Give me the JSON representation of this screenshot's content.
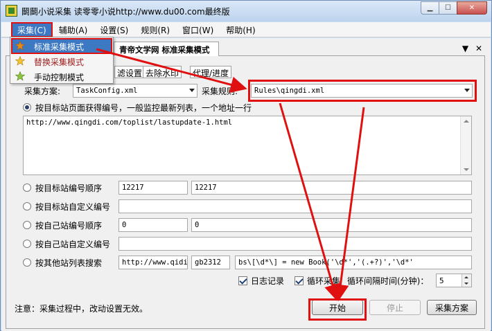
{
  "window": {
    "title": "鬬鬬小说采集 读零零小说http://www.du00.com最终版",
    "controls": [
      "minimize-icon",
      "maximize-icon",
      "close-icon"
    ]
  },
  "menubar": {
    "items": [
      "采集(C)",
      "辅助(A)",
      "设置(S)",
      "规则(R)",
      "窗口(W)",
      "帮助(H)"
    ],
    "active_index": 0
  },
  "dropdown": {
    "items": [
      {
        "label": "标准采集模式",
        "icon": "star-icon",
        "highlighted": true
      },
      {
        "label": "替换采集模式",
        "icon": "star-icon"
      },
      {
        "label": "手动控制模式",
        "icon": "star-icon"
      }
    ]
  },
  "document_tab": {
    "label": "青帝文学网 标准采集模式",
    "controls": [
      "▼",
      "✕"
    ]
  },
  "sub_tabs": [
    "滤设置",
    "去除水印",
    "代理/进度"
  ],
  "scheme": {
    "label": "采集方案:",
    "value": "TaskConfig.xml"
  },
  "rule": {
    "label": "采集规则:",
    "value": "Rules\\qingdi.xml"
  },
  "options": {
    "list_mode": {
      "label": "按目标站页面获得编号，一般监控最新列表，一个地址一行",
      "selected": true,
      "url": "http://www.qingdi.com/toplist/lastupdate-1.html"
    },
    "target_seq": {
      "label": "按目标站编号顺序",
      "from": "12217",
      "to": "12217"
    },
    "target_custom": {
      "label": "按目标站自定义编号",
      "value": ""
    },
    "own_seq": {
      "label": "按自己站编号顺序",
      "from": "0",
      "to": "0"
    },
    "own_custom": {
      "label": "按自己站自定义编号",
      "value": ""
    },
    "other_search": {
      "label": "按其他站列表搜索",
      "url": "http://www.qidis",
      "encoding": "gb2312",
      "pattern": "bs\\[\\d*\\] = new Book('\\d*','(.+?)','\\d*'"
    }
  },
  "footer": {
    "log_label": "日志记录",
    "log_checked": true,
    "loop_label": "循环采集",
    "loop_checked": true,
    "interval_label": "循环间隔时间(分钟)：",
    "interval_value": "5",
    "note": "注意：采集过程中，改动设置无效。",
    "start_label": "开始",
    "stop_label": "停止",
    "scheme_label": "采集方案"
  },
  "colors": {
    "highlight_red": "#e01010",
    "menu_selection": "#3d78c2",
    "window_frame": "#c9dcf2"
  }
}
